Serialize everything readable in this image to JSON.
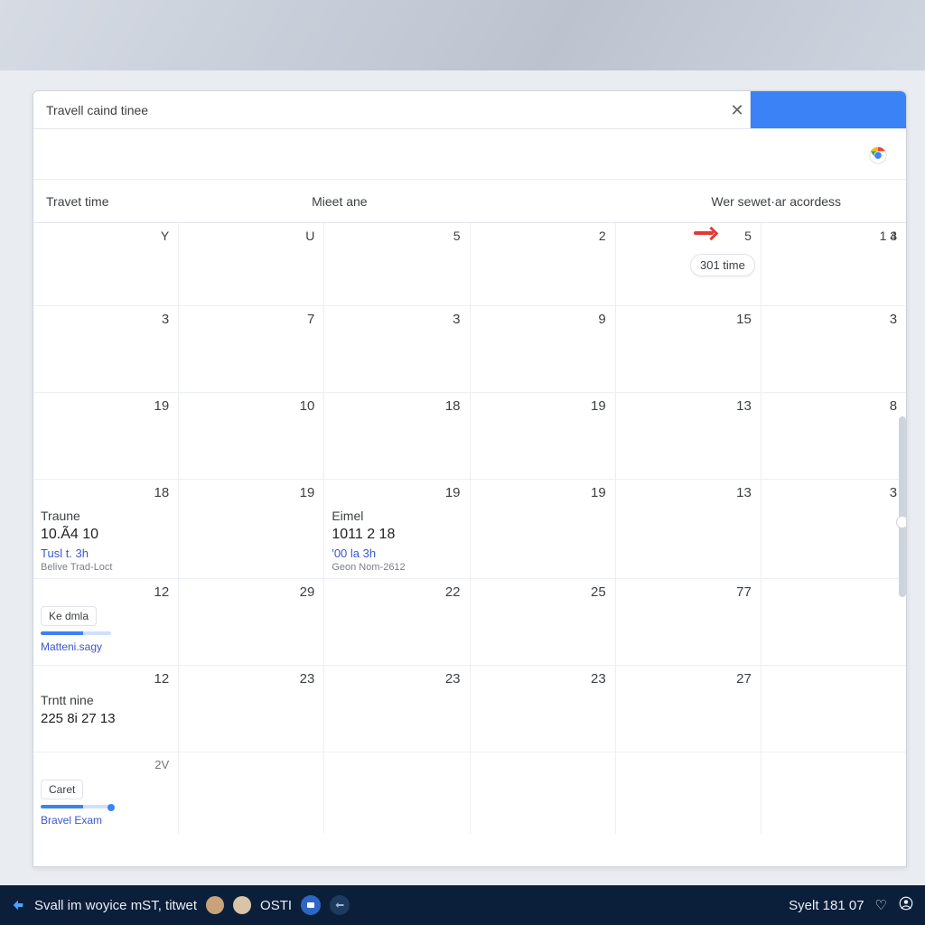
{
  "tab": {
    "title": "Travell caind tinee",
    "close_glyph": "✕"
  },
  "columns": {
    "a": "Travet time",
    "b": "Mieet ane",
    "c": "Wer sewet·ar acordess"
  },
  "weekday_heads": [
    "Y",
    "U",
    "5",
    "2",
    "5",
    "1 3",
    "4"
  ],
  "today_pill": "301 time",
  "rows": [
    {
      "nums": [
        "3",
        "7",
        "3",
        "9",
        "15",
        "3"
      ]
    },
    {
      "nums": [
        "19",
        "10",
        "18",
        "19",
        "13",
        "8"
      ]
    },
    {
      "nums": [
        "18",
        "19",
        "19",
        "19",
        "13",
        "3"
      ]
    },
    {
      "nums": [
        "12",
        "29",
        "22",
        "25",
        "77",
        ""
      ]
    },
    {
      "nums": [
        "12",
        "23",
        "23",
        "23",
        "27",
        ""
      ]
    },
    {
      "nums": [
        "2V",
        "",
        "",
        "",
        "",
        ""
      ]
    }
  ],
  "events": {
    "sun_block": {
      "title": "Traune",
      "line1": "10.Ã4   10",
      "line2": "Tusl t.   3h",
      "line3": "Belive Trad-Loct"
    },
    "tue_block": {
      "title": "Eimel",
      "line1": "1011 2   18",
      "line2": "'00 la   3h",
      "line3": "Geon Nom-2612"
    },
    "row4_chip": "Ke dmla",
    "row4_link": "Matteni.sagy",
    "row5_title": "Trntt nine",
    "row5_line": "225 8i 27 13",
    "row6_chip": "Caret",
    "row6_link": "Bravel Exam"
  },
  "taskbar": {
    "left_text": "Svall im woyice mST, titwet",
    "center_text": "OSTI",
    "right_text": "Syelt 181 07"
  }
}
